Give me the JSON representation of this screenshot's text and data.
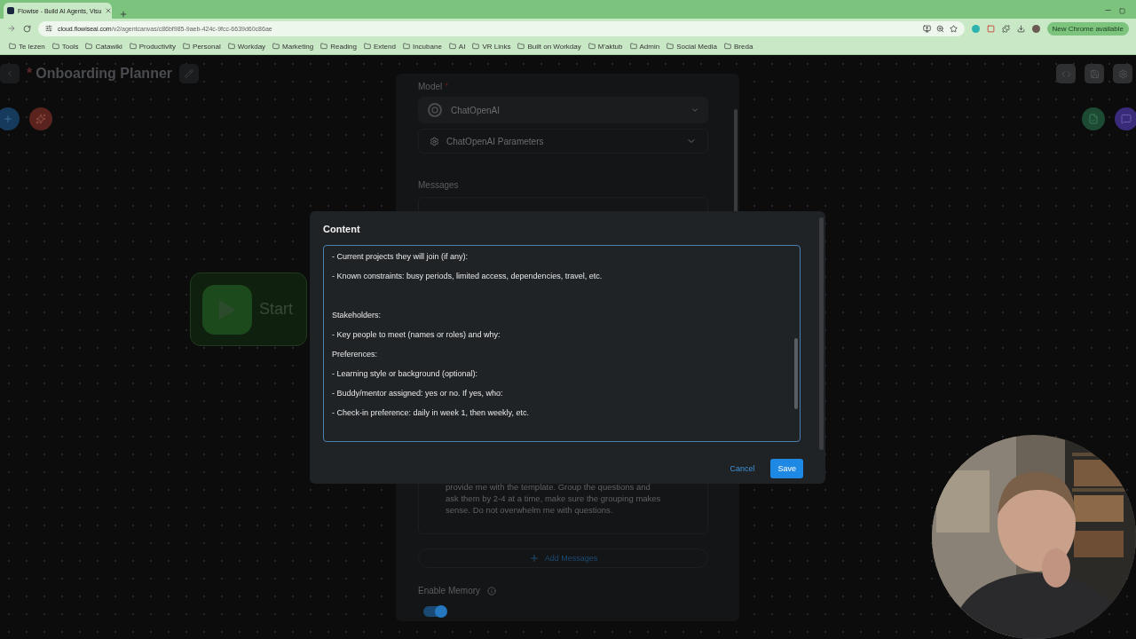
{
  "browser": {
    "tab": {
      "title": "Flowise - Build AI Agents, Visu"
    },
    "url_host": "cloud.flowiseai.com",
    "url_path": "/v2/agentcanvas/c86bf985-9aeb-424c-9fcc-6639d60c86ae",
    "bookmarks": [
      "Te lezen",
      "Tools",
      "Catawiki",
      "Productivity",
      "Personal",
      "Workday",
      "Marketing",
      "Reading",
      "Extend",
      "Incubane",
      "AI",
      "VR Links",
      "Built on Workday",
      "M'aktub",
      "Admin",
      "Social Media",
      "Breda"
    ],
    "update_button": "New Chrome available"
  },
  "canvas": {
    "title_mark": "*",
    "title": "Onboarding Planner",
    "nodes": [
      {
        "label": "Start"
      }
    ]
  },
  "node_panel": {
    "model_label": "Model",
    "required_mark": "*",
    "model_value": "ChatOpenAI",
    "parameters_label": "ChatOpenAI Parameters",
    "messages_label": "Messages",
    "message_text": "provide me with the template. Group the questions and ask them by 2-4 at a time, make sure the grouping makes sense. Do not overwhelm me with questions.",
    "add_button": "Add Messages",
    "memory_label": "Enable Memory",
    "memory_on": true
  },
  "dialog": {
    "title": "Content",
    "blocks": [
      [
        "- Current projects they will join (if any):",
        "- Known constraints: busy periods, limited access, dependencies, travel, etc."
      ],
      [
        "Stakeholders:",
        "- Key people to meet (names or roles) and why:",
        "Preferences:",
        "- Learning style or background (optional):",
        "- Buddy/mentor assigned: yes or no. If yes, who:",
        "- Check-in preference: daily in week 1, then weekly, etc."
      ]
    ],
    "buttons": [
      {
        "label": "Cancel",
        "kind": "text"
      },
      {
        "label": "Save",
        "kind": "primary"
      }
    ]
  }
}
